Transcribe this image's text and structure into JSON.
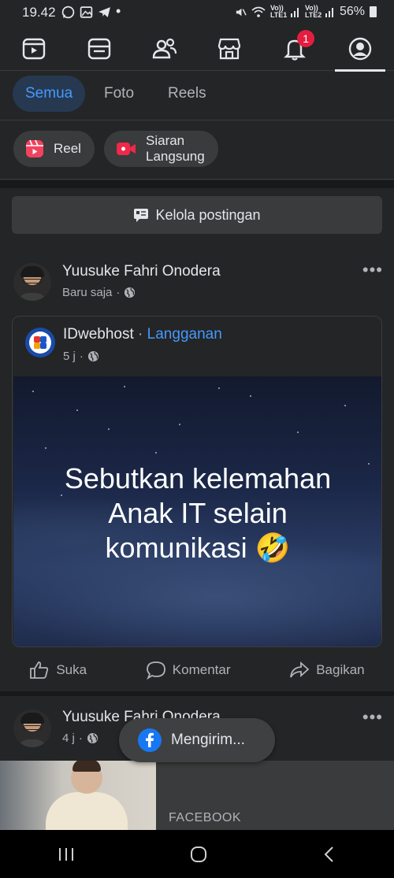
{
  "status_bar": {
    "time": "19.42",
    "left_icons": [
      "whatsapp-icon",
      "gallery-icon",
      "telegram-icon",
      "dot-icon"
    ],
    "sim1_label": "Vo)) LTE1",
    "sim2_label": "Vo)) LTE2",
    "battery": "56%"
  },
  "top_nav": {
    "items": [
      "video-icon",
      "feed-icon",
      "friends-icon",
      "marketplace-icon",
      "notifications-icon",
      "profile-icon"
    ],
    "notification_count": "1",
    "active": "profile"
  },
  "filters": [
    "Semua",
    "Foto",
    "Reels"
  ],
  "create": {
    "reel_label": "Reel",
    "live_label_line1": "Siaran",
    "live_label_line2": "Langsung"
  },
  "manage_posts_label": "Kelola postingan",
  "post1": {
    "author": "Yuusuke Fahri Onodera",
    "time": "Baru saja",
    "shared": {
      "page_name": "IDwebhost",
      "separator": " · ",
      "subscribe_label": "Langganan",
      "time": "5 j",
      "image_text_line1": "Sebutkan kelemahan",
      "image_text_line2": "Anak IT selain",
      "image_text_line3": "komunikasi 🤣"
    }
  },
  "actions": {
    "like": "Suka",
    "comment": "Komentar",
    "share": "Bagikan"
  },
  "post2": {
    "author": "Yuusuke Fahri Onodera",
    "time": "4 j",
    "link_domain": "FACEBOOK"
  },
  "toast": {
    "label": "Mengirim..."
  },
  "colors": {
    "background": "#242526",
    "accent": "#4599ff",
    "badge": "#e41e3f",
    "facebook_blue": "#1877f2"
  }
}
